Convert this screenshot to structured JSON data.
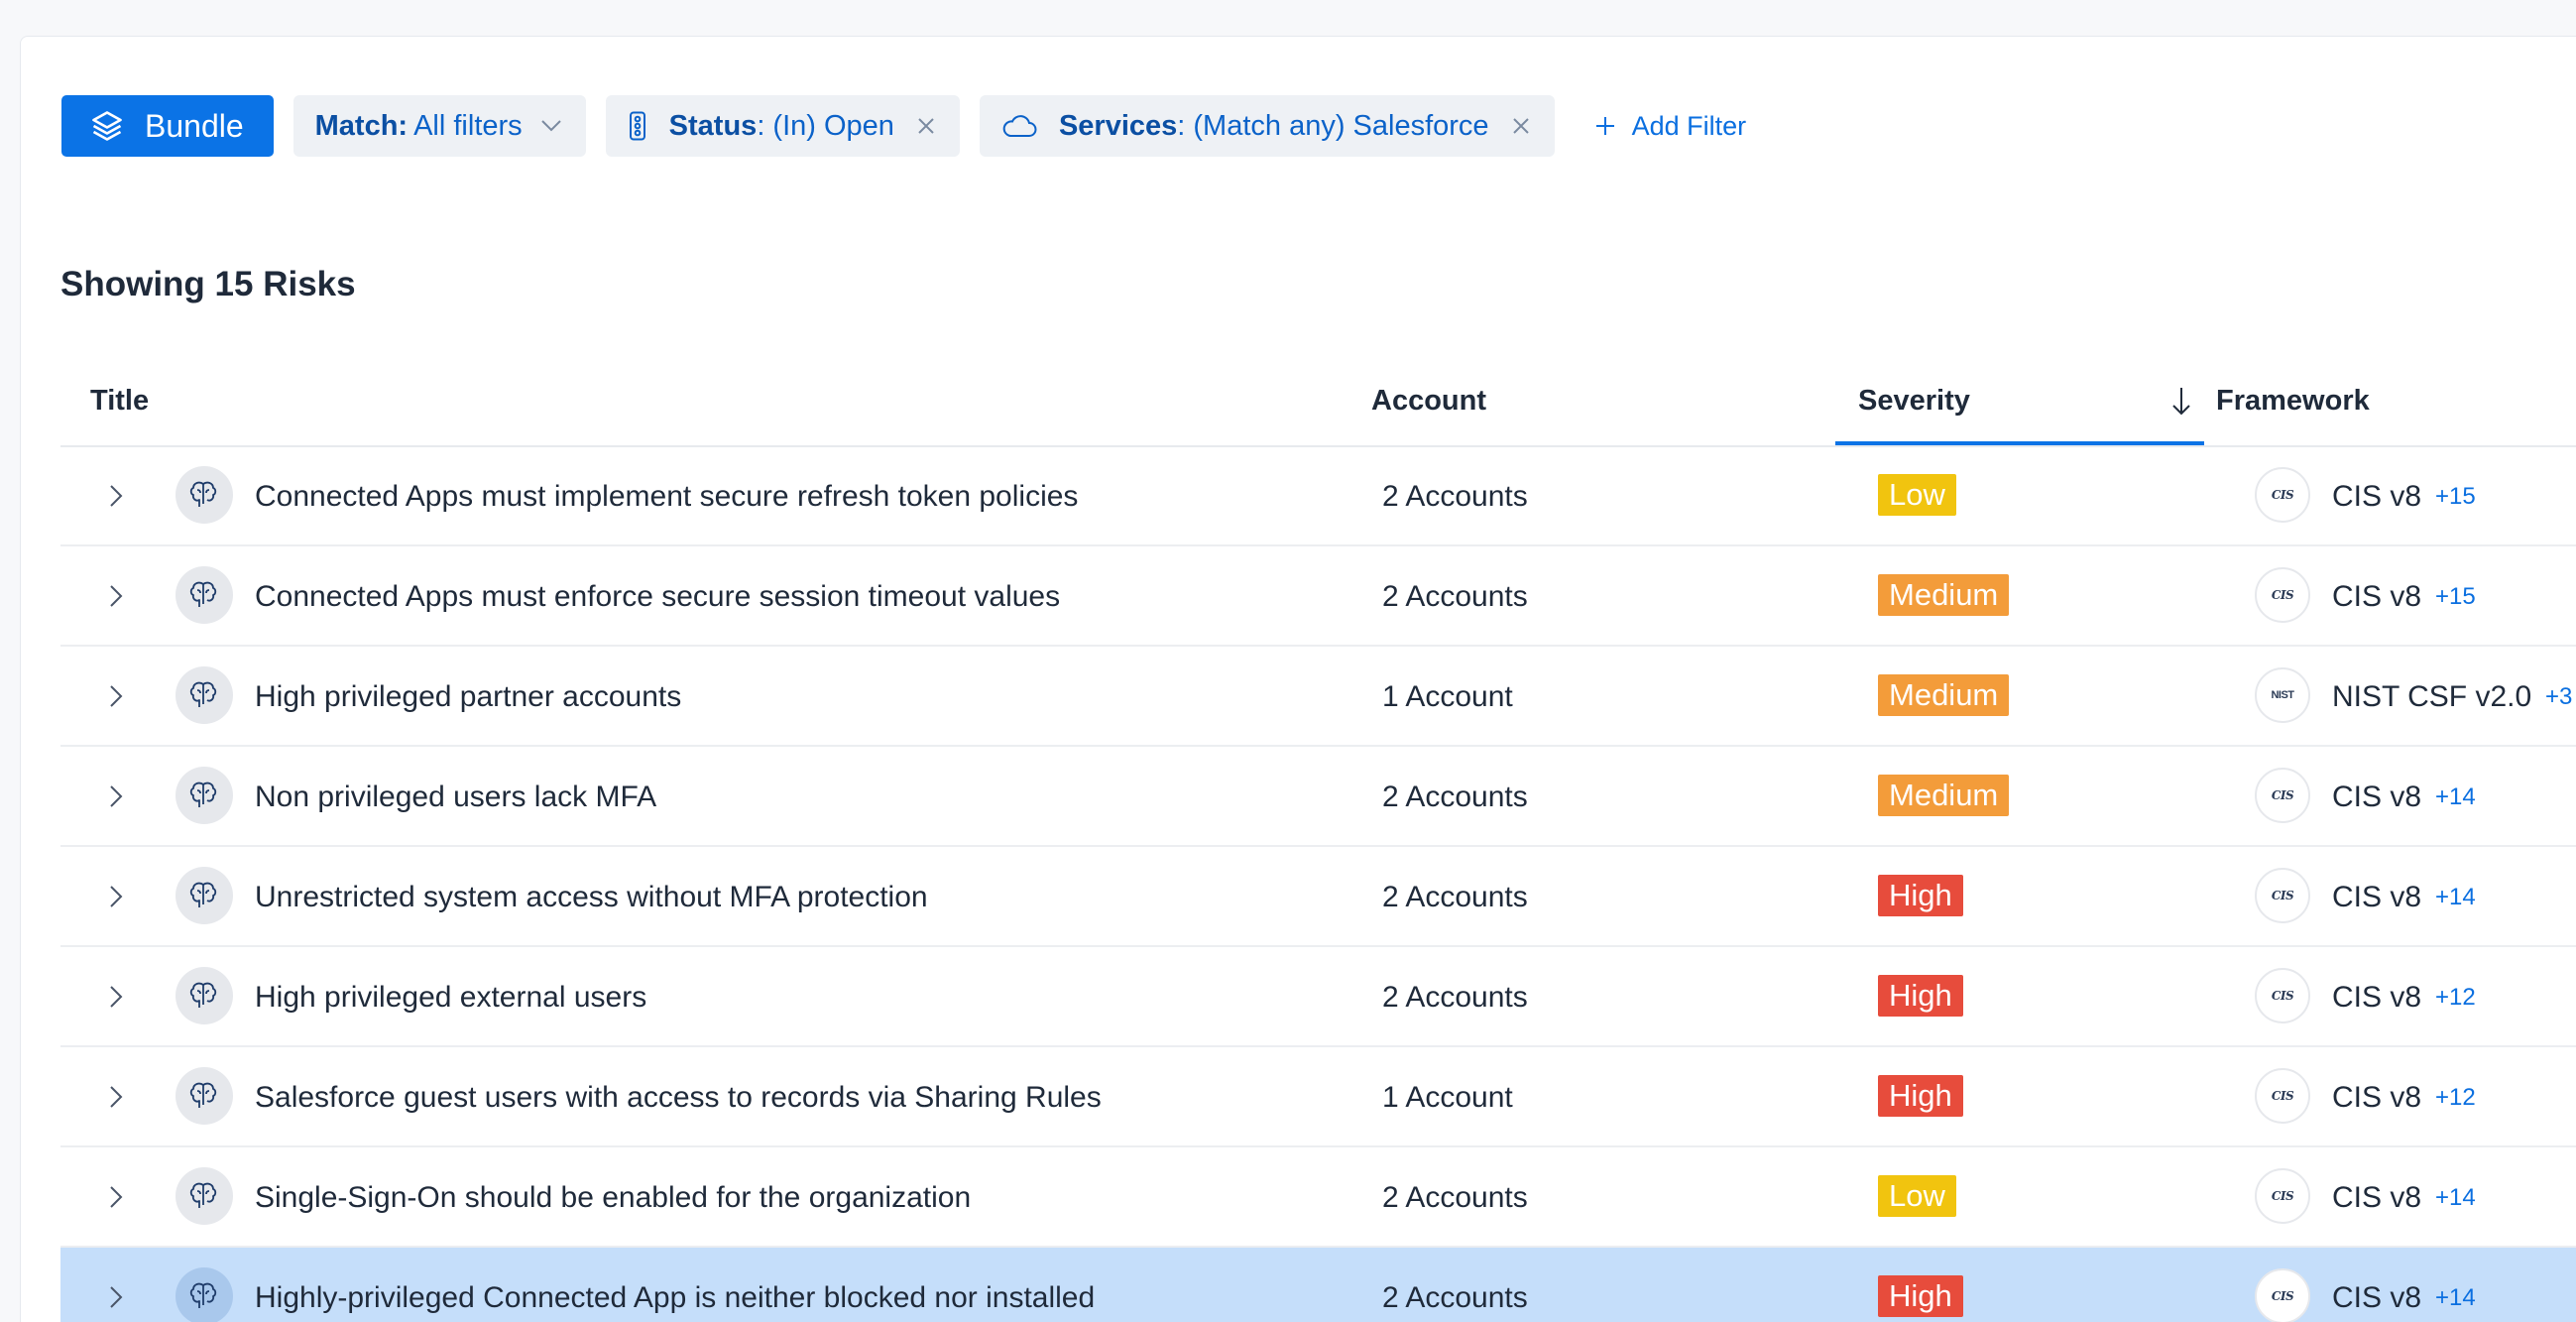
{
  "filters": {
    "bundle_label": "Bundle",
    "match": {
      "key": "Match:",
      "value": "All filters"
    },
    "status": {
      "key": "Status",
      "value": ": (In) Open"
    },
    "services": {
      "key": "Services",
      "value": ": (Match any) Salesforce"
    },
    "add_filter_label": "Add Filter"
  },
  "summary": {
    "heading": "Showing 15 Risks"
  },
  "table": {
    "columns": {
      "title": "Title",
      "account": "Account",
      "severity": "Severity",
      "framework": "Framework"
    },
    "sort": {
      "column": "severity",
      "direction": "descending"
    },
    "rows": [
      {
        "title": "Connected Apps must implement secure refresh token policies",
        "account": "2 Accounts",
        "severity": "Low",
        "severity_level": "low",
        "framework_logo": "CIS",
        "framework": "CIS v8",
        "more": "+15"
      },
      {
        "title": "Connected Apps must enforce secure session timeout values",
        "account": "2 Accounts",
        "severity": "Medium",
        "severity_level": "medium",
        "framework_logo": "CIS",
        "framework": "CIS v8",
        "more": "+15"
      },
      {
        "title": "High privileged partner accounts",
        "account": "1 Account",
        "severity": "Medium",
        "severity_level": "medium",
        "framework_logo": "NIST",
        "framework": "NIST CSF v2.0",
        "more": "+3"
      },
      {
        "title": "Non privileged users lack MFA",
        "account": "2 Accounts",
        "severity": "Medium",
        "severity_level": "medium",
        "framework_logo": "CIS",
        "framework": "CIS v8",
        "more": "+14"
      },
      {
        "title": "Unrestricted system access without MFA protection",
        "account": "2 Accounts",
        "severity": "High",
        "severity_level": "high",
        "framework_logo": "CIS",
        "framework": "CIS v8",
        "more": "+14"
      },
      {
        "title": "High privileged external users",
        "account": "2 Accounts",
        "severity": "High",
        "severity_level": "high",
        "framework_logo": "CIS",
        "framework": "CIS v8",
        "more": "+12"
      },
      {
        "title": "Salesforce guest users with access to records via Sharing Rules",
        "account": "1 Account",
        "severity": "High",
        "severity_level": "high",
        "framework_logo": "CIS",
        "framework": "CIS v8",
        "more": "+12"
      },
      {
        "title": "Single-Sign-On should be enabled for the organization",
        "account": "2 Accounts",
        "severity": "Low",
        "severity_level": "low",
        "framework_logo": "CIS",
        "framework": "CIS v8",
        "more": "+14"
      },
      {
        "title": "Highly-privileged Connected App is neither blocked nor installed",
        "account": "2 Accounts",
        "severity": "High",
        "severity_level": "high",
        "framework_logo": "CIS",
        "framework": "CIS v8",
        "more": "+14",
        "selected": true
      }
    ]
  },
  "icons": {
    "bundle": "layers-icon",
    "status": "traffic-light-icon",
    "services": "cloud-icon",
    "remove": "close-icon",
    "dropdown": "chevron-down-icon",
    "add": "plus-icon",
    "expand": "chevron-right-icon",
    "risk": "brain-icon",
    "sort": "arrow-down-icon"
  },
  "colors": {
    "accent": "#0b73e6",
    "low": "#f1c40f",
    "medium": "#f39c3a",
    "high": "#e74c3c",
    "selected_row": "#c5defa"
  }
}
